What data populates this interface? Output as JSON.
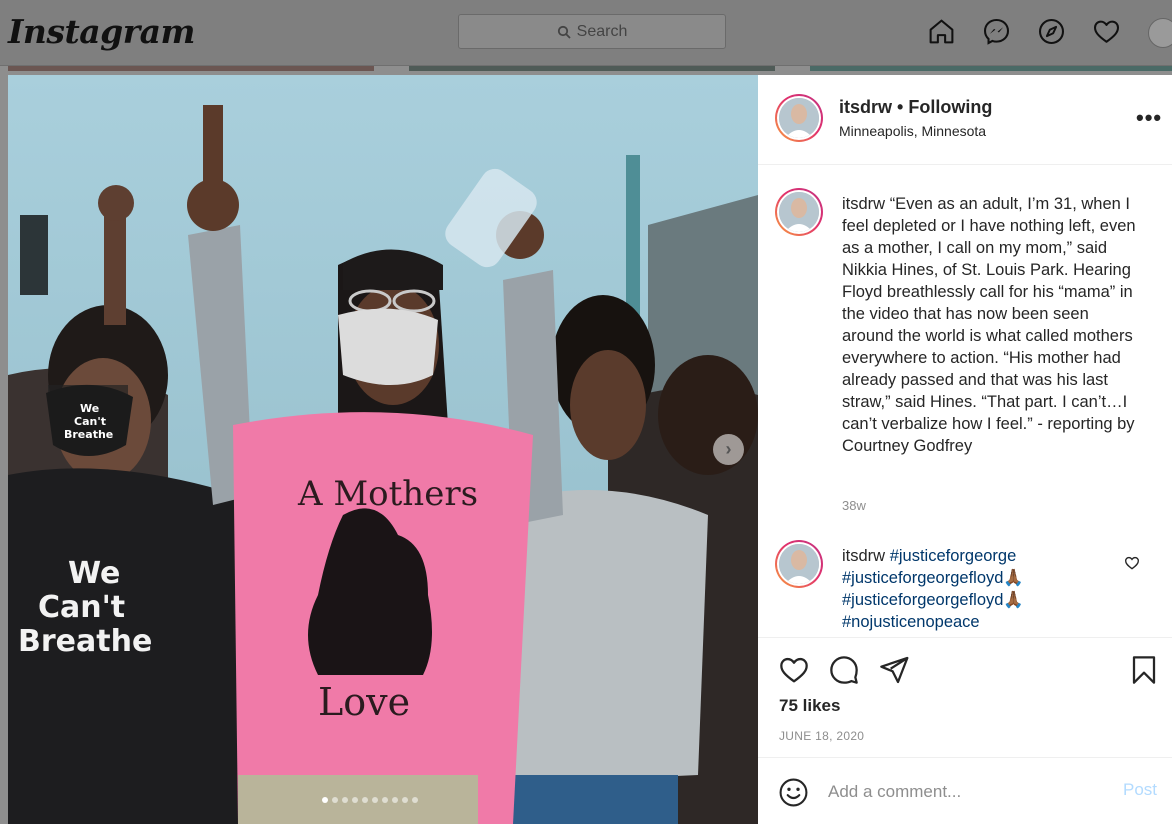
{
  "app": {
    "logo": "Instagram"
  },
  "search": {
    "placeholder": "Search"
  },
  "nav": {
    "icons": [
      "home-icon",
      "messenger-icon",
      "explore-icon",
      "activity-heart-icon",
      "profile-avatar"
    ]
  },
  "post": {
    "author": "itsdrw",
    "separator": "•",
    "follow_status": "Following",
    "location": "Minneapolis, Minnesota",
    "more_label": "•••",
    "caption_user": "itsdrw",
    "caption_text": "“Even as an adult, I’m 31, when I feel depleted or I have nothing left, even as a mother, I call on my mom,” said Nikkia Hines, of St. Louis Park. Hearing Floyd breathlessly call for his “mama” in the video that has now been seen around the world is what called mothers everywhere to action. “His mother had already passed and that was his last straw,” said Hines. “That part. I can’t…I can’t verbalize how I feel.” - reporting by Courtney Godfrey",
    "caption_age": "38w",
    "comment_user": "itsdrw",
    "comment_tags": [
      "#justiceforgeorge",
      "#justiceforgeorgefloyd🙏🏾",
      "#justiceforgeorgefloyd🙏🏾",
      "#nojusticenopeace"
    ],
    "likes": "75 likes",
    "date": "JUNE 18, 2020",
    "comment_placeholder": "Add a comment...",
    "post_button": "Post",
    "carousel": {
      "count": 10,
      "active_index": 0
    }
  },
  "photo": {
    "shirt_text_top": "A Mothers",
    "shirt_text_bottom": "Love",
    "shirt_left_line1": "We",
    "shirt_left_line2": "Can't",
    "shirt_left_line3": "Breathe",
    "mask_line1": "We",
    "mask_line2": "Can't",
    "mask_line3": "Breathe"
  },
  "colors": {
    "link": "#00376b",
    "post_disabled": "#b3dbff",
    "muted": "#8e8e8e",
    "shirt_pink": "#f07aa8"
  }
}
